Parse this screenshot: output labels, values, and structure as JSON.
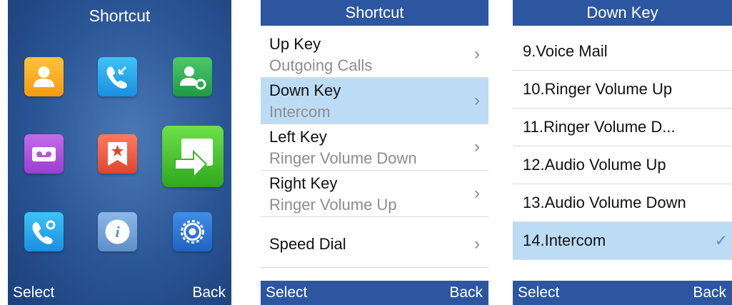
{
  "screen1": {
    "title": "Shortcut",
    "softkeys": {
      "left": "Select",
      "right": "Back"
    },
    "icons": [
      "contacts-icon",
      "call-history-icon",
      "directory-settings-icon",
      "voicemail-icon",
      "favorites-icon",
      "intercom-icon",
      "call-settings-icon",
      "info-icon",
      "settings-icon"
    ]
  },
  "screen2": {
    "title": "Shortcut",
    "items": [
      {
        "label": "Up Key",
        "value": "Outgoing Calls"
      },
      {
        "label": "Down Key",
        "value": "Intercom",
        "selected": true
      },
      {
        "label": "Left Key",
        "value": "Ringer Volume Down"
      },
      {
        "label": "Right Key",
        "value": "Ringer Volume Up"
      },
      {
        "label": "Speed Dial"
      }
    ],
    "softkeys": {
      "left": "Select",
      "right": "Back"
    }
  },
  "screen3": {
    "title": "Down Key",
    "options": [
      {
        "label": "9.Voice Mail"
      },
      {
        "label": "10.Ringer Volume Up"
      },
      {
        "label": "11.Ringer Volume D..."
      },
      {
        "label": "12.Audio Volume Up"
      },
      {
        "label": "13.Audio Volume Down"
      },
      {
        "label": "14.Intercom",
        "selected": true,
        "checked": true
      }
    ],
    "softkeys": {
      "left": "Select",
      "right": "Back"
    }
  },
  "chevron": "›",
  "checkmark": "✓"
}
